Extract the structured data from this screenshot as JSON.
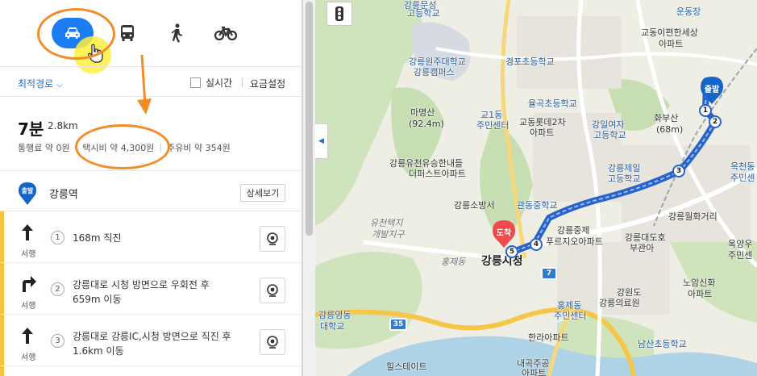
{
  "modes": [
    {
      "name": "car",
      "icon": "car-icon",
      "active": true
    },
    {
      "name": "bus",
      "icon": "bus-icon"
    },
    {
      "name": "walk",
      "icon": "walk-icon"
    },
    {
      "name": "bike",
      "icon": "bike-icon"
    }
  ],
  "options": {
    "route_type": "최적경로",
    "realtime_label": "실시간",
    "fare_setting": "요금설정"
  },
  "summary": {
    "time": "7분",
    "distance": "2.8km",
    "toll": "통행료 약 0원",
    "taxi": "택시비 약 4,300원",
    "fuel": "주유비 약 354원"
  },
  "start": {
    "badge": "출발",
    "name": "강릉역",
    "detail_button": "상세보기"
  },
  "steps": [
    {
      "num": "1",
      "dir": "서행",
      "text": "168m 직진"
    },
    {
      "num": "2",
      "dir": "서행",
      "text_line1": "강릉대로 시청 방면으로 우회전 후",
      "text_line2": "659m 이동"
    },
    {
      "num": "3",
      "dir": "서행",
      "text_line1": "강릉대로 강릉IC,시청 방면으로 직진 후",
      "text_line2": "1.6km 이동"
    }
  ],
  "map": {
    "labels": {
      "l1": "강릉문성",
      "l2": "고등학교",
      "l3": "강릉원주대학교",
      "l4": "강릉캠퍼스",
      "l5": "마명산",
      "l6": "(92.4m)",
      "l7": "교1동",
      "l8": "주민센터",
      "l9": "경포초등학교",
      "l10": "율곡초등학교",
      "l11": "교동이편한세상",
      "l12": "아파트",
      "l13": "운동장",
      "l14": "교동롯데2차",
      "l15": "아파트",
      "l16": "강일여자",
      "l17": "고등학교",
      "l18": "화부산",
      "l19": "(68m)",
      "l20": "옥천동",
      "l21": "주민센",
      "l22": "강릉유천유승한내들",
      "l23": "더퍼스트아파트",
      "l24": "강릉제일",
      "l25": "고등학교",
      "l26": "강릉소방서",
      "l27": "관동중학교",
      "l28": "강릉월화거리",
      "l29": "유천택지",
      "l30": "개발지구",
      "l31": "강릉시청",
      "l32": "홍제동",
      "l33": "강릉중제",
      "l34": "푸르지오아파트",
      "l35": "강릉대도호",
      "l36": "부관아",
      "l37": "강원도",
      "l38": "강릉의료원",
      "l39": "홍제동",
      "l40": "주민센터",
      "l41": "노암신화",
      "l42": "아파트",
      "l43": "강릉영동",
      "l44": "대학교",
      "l45": "한라아파트",
      "l46": "남산초등학교",
      "l47": "내곡주공",
      "l48": "아파트",
      "l49": "힐스테이트",
      "l50": "옥양우",
      "l51": "주민센"
    },
    "start_badge": "출발",
    "end_badge": "도착",
    "waypoints": [
      "1",
      "2",
      "3",
      "4",
      "5"
    ],
    "road_shields": [
      "35",
      "7"
    ],
    "route_color": "#2a62c8"
  },
  "colors": {
    "accent": "#1c7cf2",
    "annotation": "#f28c28"
  }
}
